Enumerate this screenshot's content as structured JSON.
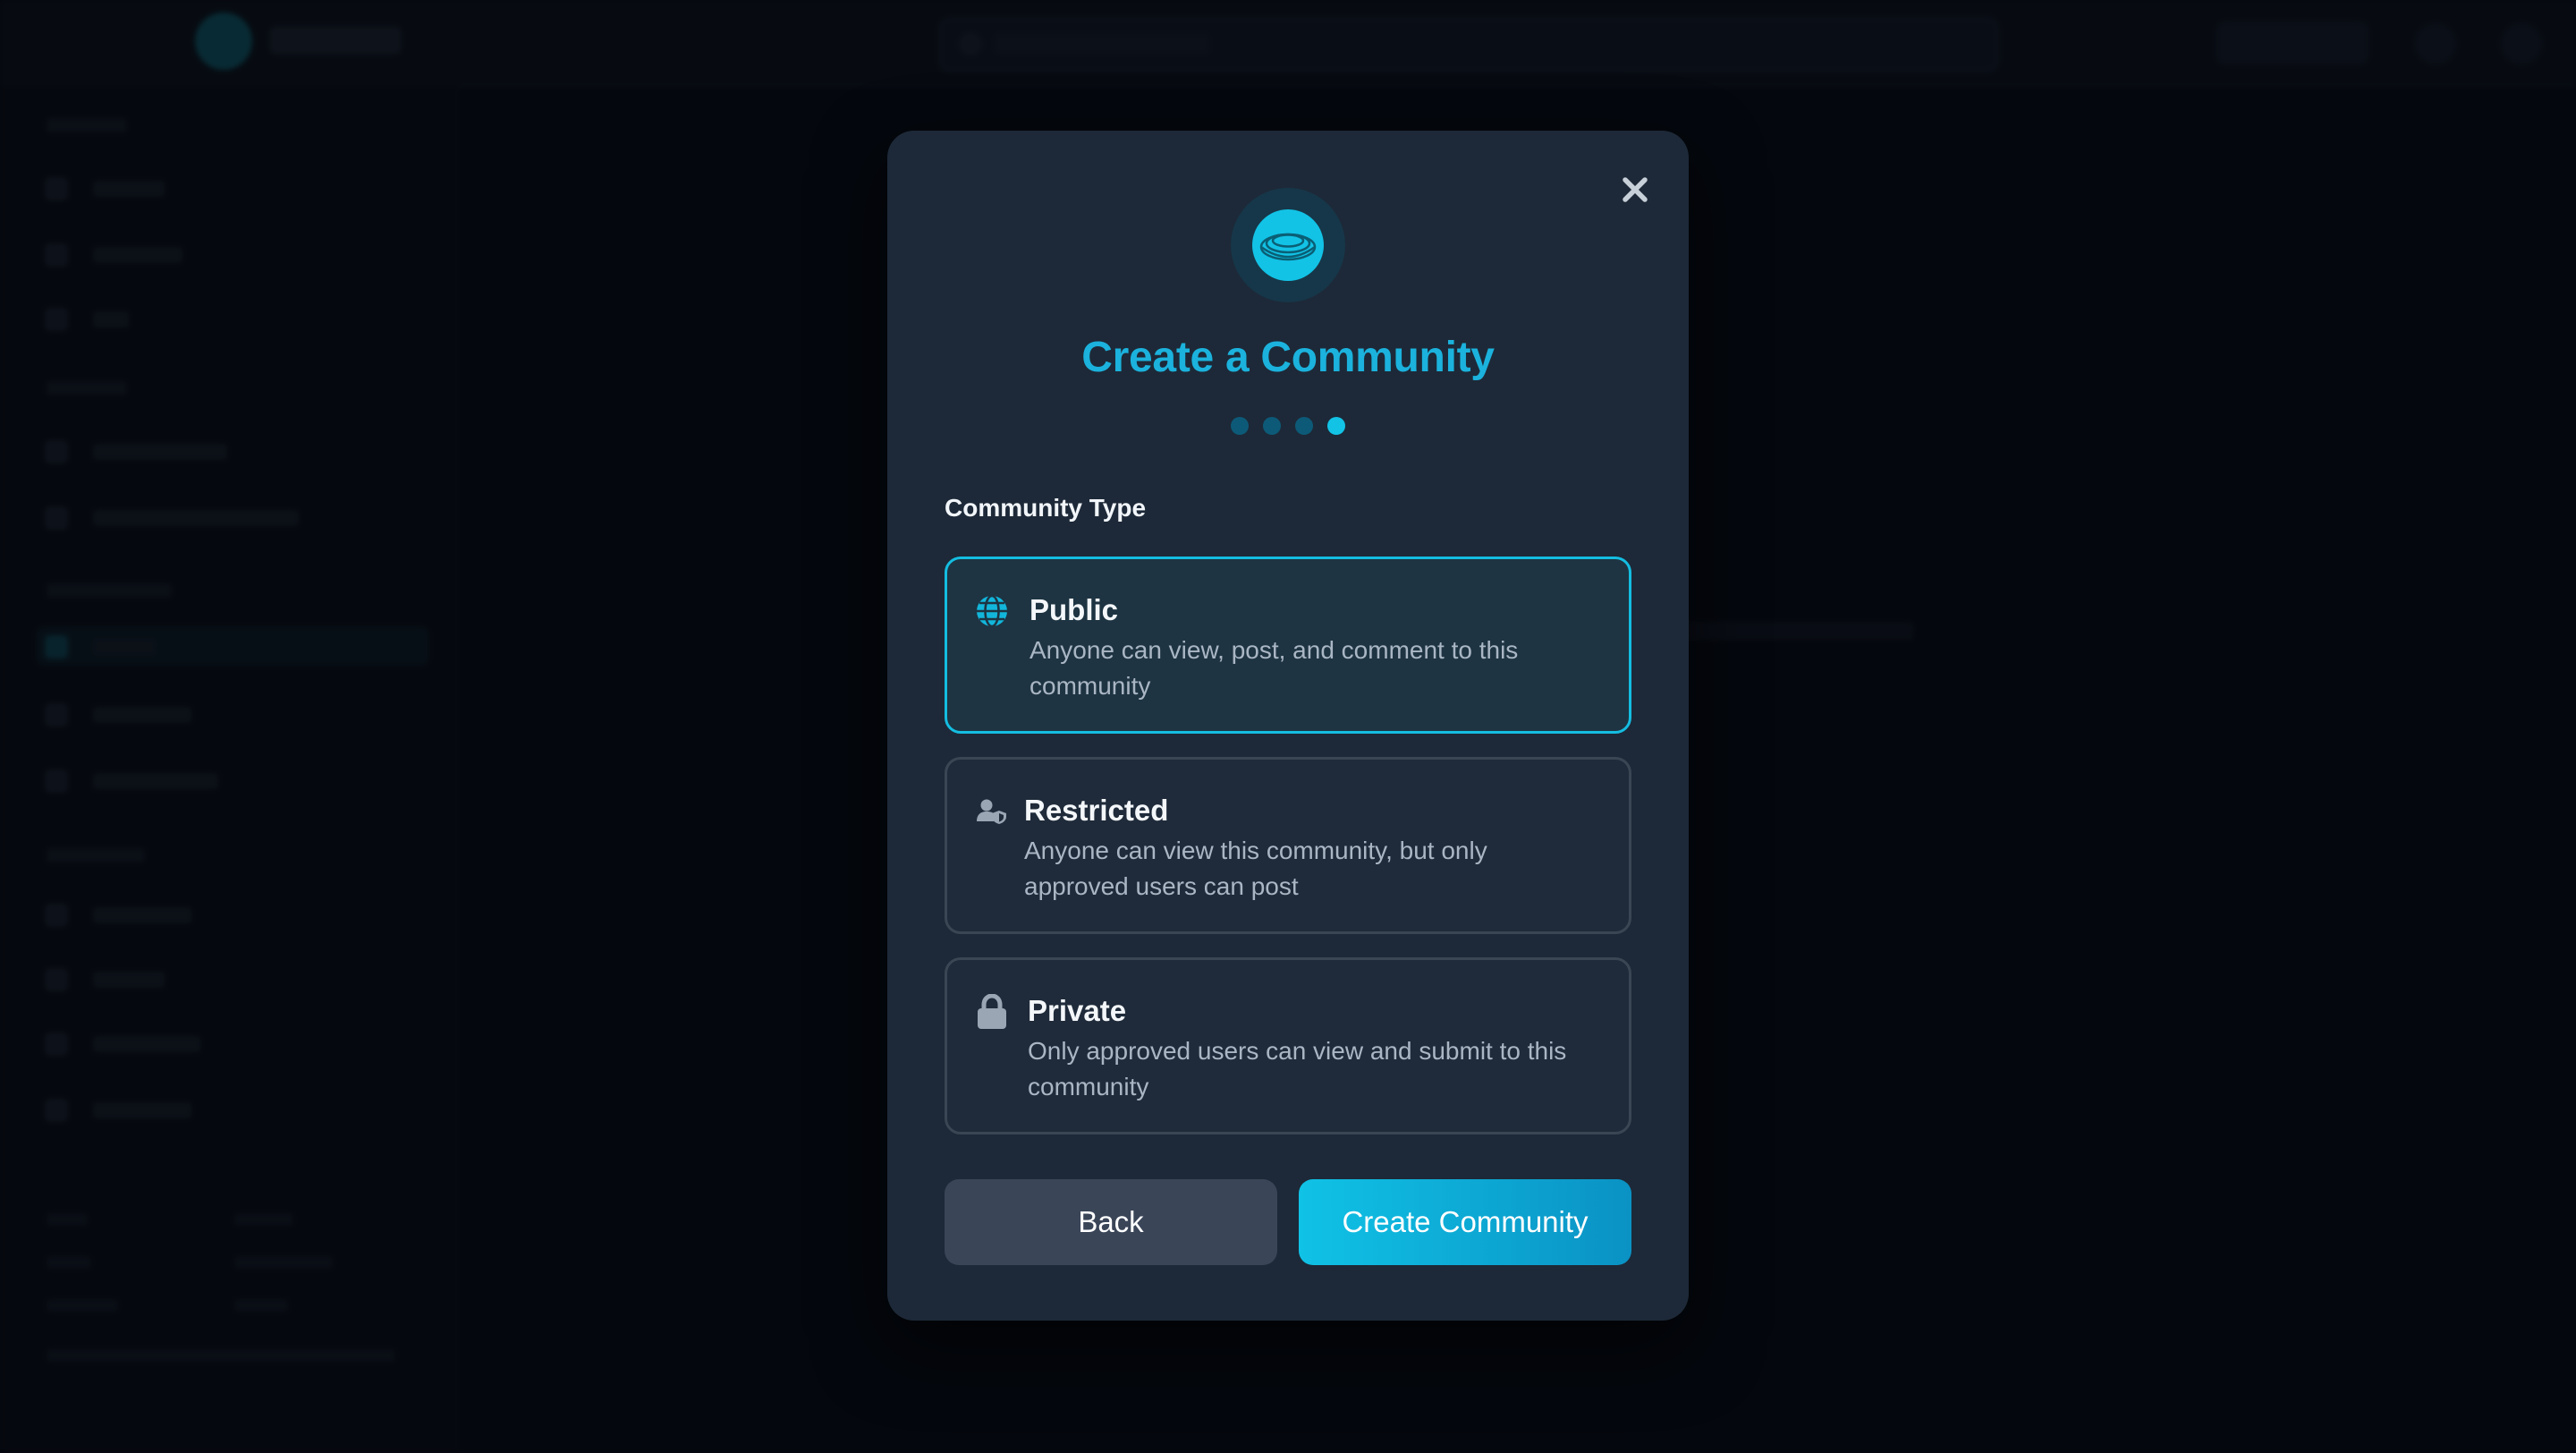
{
  "modal": {
    "title": "Create a Community",
    "step_count": 4,
    "current_step": 4,
    "section_label": "Community Type",
    "close_label": "×",
    "options": [
      {
        "id": "public",
        "icon": "globe-icon",
        "title": "Public",
        "description": "Anyone can view, post, and comment to this community",
        "selected": true
      },
      {
        "id": "restricted",
        "icon": "user-shield-icon",
        "title": "Restricted",
        "description": "Anyone can view this community, but only approved users can post",
        "selected": false
      },
      {
        "id": "private",
        "icon": "lock-icon",
        "title": "Private",
        "description": "Only approved users can view and submit to this community",
        "selected": false
      }
    ],
    "back_label": "Back",
    "create_label": "Create Community"
  },
  "colors": {
    "accent": "#12c3e6",
    "title": "#1bb2dd",
    "modal_bg": "#1d2938",
    "selected_border": "#14bde1",
    "page_bg": "#060a11"
  }
}
